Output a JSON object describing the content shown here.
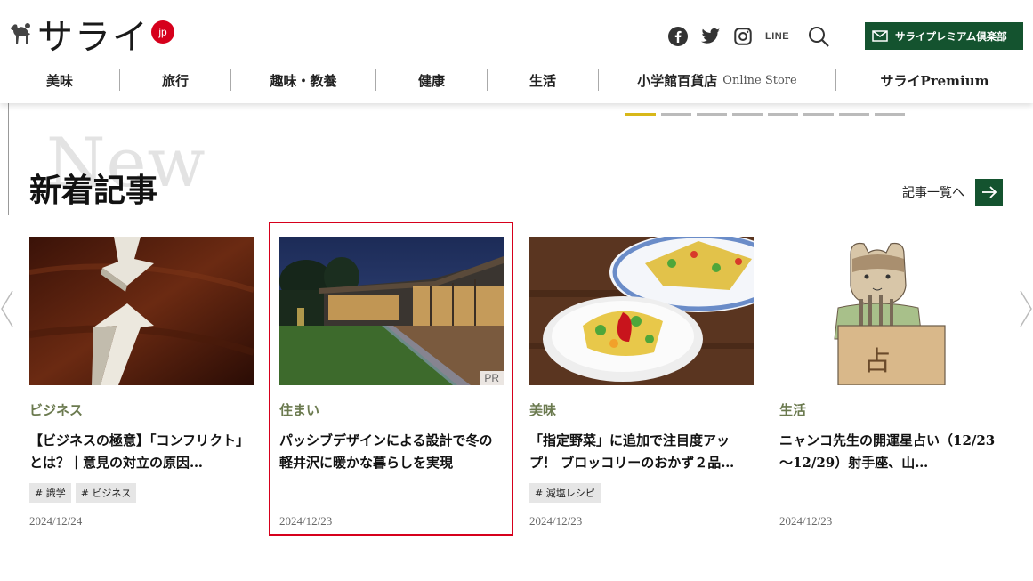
{
  "logo": {
    "text": "サライ",
    "badge": "jp"
  },
  "header": {
    "social": [
      "facebook-icon",
      "twitter-icon",
      "instagram-icon",
      "line-icon",
      "search-icon"
    ],
    "line_label": "LINE",
    "premium_button": "サライプレミアム倶楽部"
  },
  "nav": {
    "items": [
      {
        "label": "美味"
      },
      {
        "label": "旅行"
      },
      {
        "label": "趣味・教養"
      },
      {
        "label": "健康"
      },
      {
        "label": "生活"
      },
      {
        "label": "小学館百貨店",
        "sub": "Online Store"
      },
      {
        "label": "サライPremium"
      }
    ]
  },
  "slider": {
    "total": 8,
    "active_index": 0
  },
  "section": {
    "bg_text": "New",
    "title": "新着記事",
    "all_link": "記事一覧へ"
  },
  "cards": [
    {
      "category": "ビジネス",
      "title": "【ビジネスの極意】「コンフリクト」とは？｜意見の対立の原因…",
      "tags": [
        "# 識学",
        "# ビジネス"
      ],
      "date": "2024/12/24",
      "pr": ""
    },
    {
      "category": "住まい",
      "title": "パッシブデザインによる設計で冬の軽井沢に暖かな暮らしを実現",
      "tags": [],
      "date": "2024/12/23",
      "pr": "PR"
    },
    {
      "category": "美味",
      "title": "「指定野菜」に追加で注目度アップ！ ブロッコリーのおかず２品…",
      "tags": [
        "# 減塩レシピ"
      ],
      "date": "2024/12/23",
      "pr": ""
    },
    {
      "category": "生活",
      "title": "ニャンコ先生の開運星占い（12/23～12/29）射手座、山…",
      "tags": [],
      "date": "2024/12/23",
      "pr": ""
    }
  ],
  "colors": {
    "brand_green": "#14532f",
    "accent_red": "#d6001c",
    "category": "#6b7a4f",
    "slider_active": "#d8b81a"
  }
}
